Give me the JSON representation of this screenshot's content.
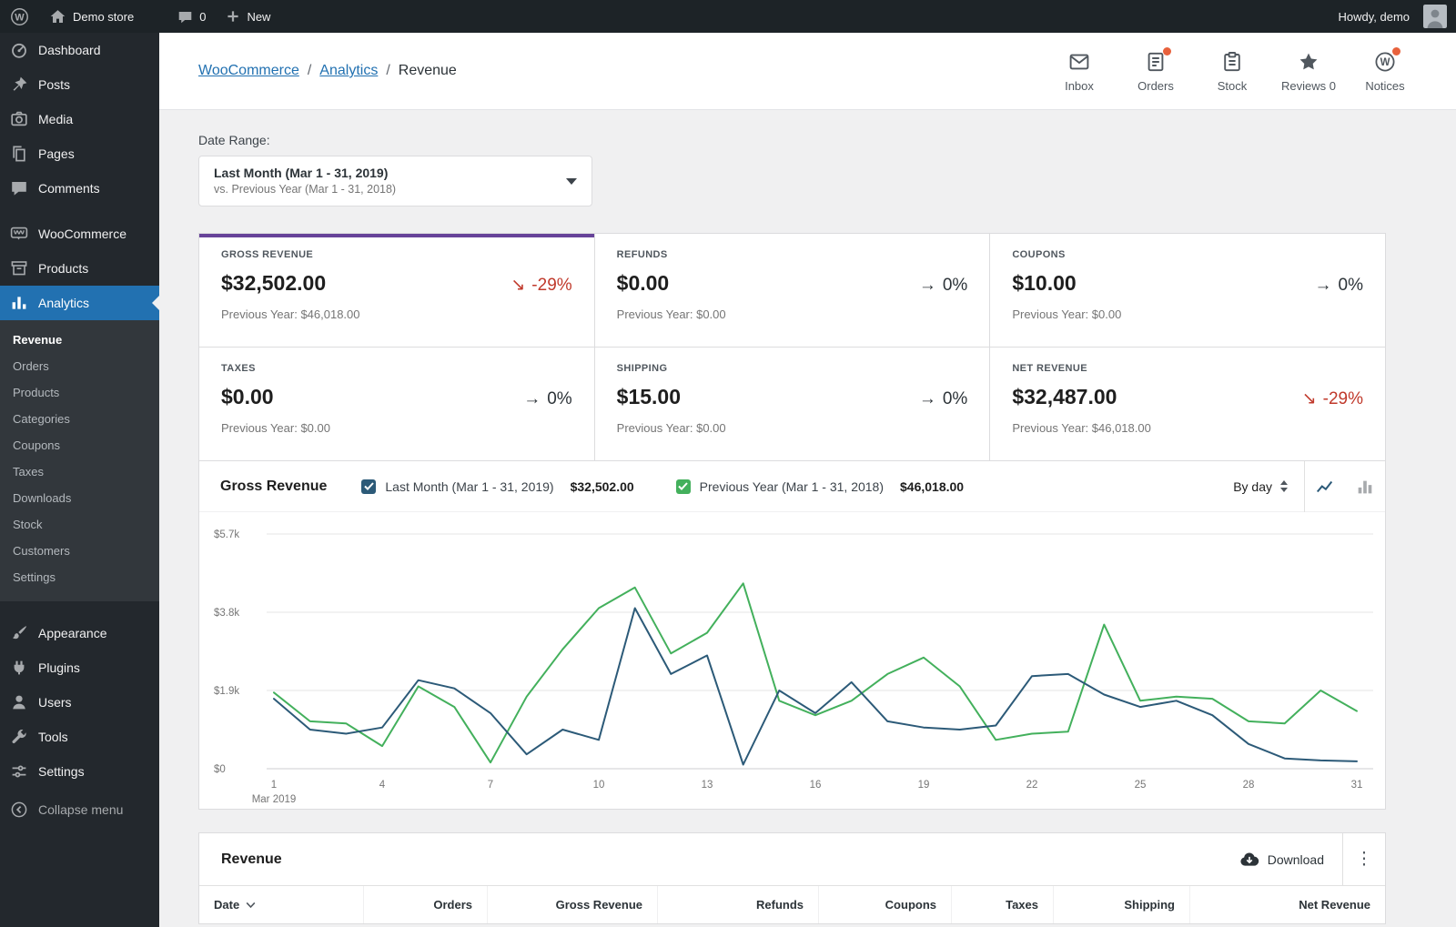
{
  "admin_bar": {
    "site_name": "Demo store",
    "comments_count": "0",
    "new_label": "New",
    "howdy": "Howdy, demo"
  },
  "sidebar": {
    "items": [
      {
        "label": "Dashboard",
        "icon": "dashboard-icon"
      },
      {
        "label": "Posts",
        "icon": "posts-icon"
      },
      {
        "label": "Media",
        "icon": "media-icon"
      },
      {
        "label": "Pages",
        "icon": "pages-icon"
      },
      {
        "label": "Comments",
        "icon": "comments-icon"
      },
      {
        "label": "WooCommerce",
        "icon": "woocommerce-icon"
      },
      {
        "label": "Products",
        "icon": "products-icon"
      },
      {
        "label": "Analytics",
        "icon": "analytics-icon"
      }
    ],
    "active_item": "Analytics",
    "analytics_submenu": [
      "Revenue",
      "Orders",
      "Products",
      "Categories",
      "Coupons",
      "Taxes",
      "Downloads",
      "Stock",
      "Customers",
      "Settings"
    ],
    "active_submenu": "Revenue",
    "lower_items": [
      {
        "label": "Appearance",
        "icon": "appearance-icon"
      },
      {
        "label": "Plugins",
        "icon": "plugins-icon"
      },
      {
        "label": "Users",
        "icon": "users-icon"
      },
      {
        "label": "Tools",
        "icon": "tools-icon"
      },
      {
        "label": "Settings",
        "icon": "settings-icon"
      }
    ],
    "collapse_label": "Collapse menu"
  },
  "header": {
    "breadcrumb": {
      "items": [
        "WooCommerce",
        "Analytics"
      ],
      "current": "Revenue",
      "separator": "/"
    },
    "tabs": [
      {
        "label": "Inbox",
        "icon": "inbox-icon",
        "unread": false
      },
      {
        "label": "Orders",
        "icon": "orders-icon",
        "unread": true
      },
      {
        "label": "Stock",
        "icon": "stock-icon",
        "unread": false
      },
      {
        "label": "Reviews 0",
        "icon": "reviews-icon",
        "unread": false
      },
      {
        "label": "Notices",
        "icon": "notices-icon",
        "unread": true
      }
    ]
  },
  "filters": {
    "date_range_label": "Date Range:",
    "selected_range": "Last Month (Mar 1 - 31, 2019)",
    "compare_range": "vs. Previous Year (Mar 1 - 31, 2018)"
  },
  "summary_cards": [
    {
      "label": "GROSS REVENUE",
      "value": "$32,502.00",
      "arrow": "↘",
      "delta": "-29%",
      "trend": "down",
      "previous": "Previous Year: $46,018.00",
      "selected": true
    },
    {
      "label": "REFUNDS",
      "value": "$0.00",
      "arrow": "→",
      "delta": "0%",
      "trend": "flat",
      "previous": "Previous Year: $0.00",
      "selected": false
    },
    {
      "label": "COUPONS",
      "value": "$10.00",
      "arrow": "→",
      "delta": "0%",
      "trend": "flat",
      "previous": "Previous Year: $0.00",
      "selected": false
    },
    {
      "label": "TAXES",
      "value": "$0.00",
      "arrow": "→",
      "delta": "0%",
      "trend": "flat",
      "previous": "Previous Year: $0.00",
      "selected": false
    },
    {
      "label": "SHIPPING",
      "value": "$15.00",
      "arrow": "→",
      "delta": "0%",
      "trend": "flat",
      "previous": "Previous Year: $0.00",
      "selected": false
    },
    {
      "label": "NET REVENUE",
      "value": "$32,487.00",
      "arrow": "↘",
      "delta": "-29%",
      "trend": "down",
      "previous": "Previous Year: $46,018.00",
      "selected": false
    }
  ],
  "chart_panel": {
    "title": "Gross Revenue",
    "series_controls": [
      {
        "label": "Last Month (Mar 1 - 31, 2019)",
        "total": "$32,502.00",
        "checked": true,
        "color": "#2c5a78"
      },
      {
        "label": "Previous Year (Mar 1 - 31, 2018)",
        "total": "$46,018.00",
        "checked": true,
        "color": "#43b05c"
      }
    ],
    "interval": "By day"
  },
  "chart_data": {
    "type": "line",
    "title": "Gross Revenue",
    "x": [
      1,
      2,
      3,
      4,
      5,
      6,
      7,
      8,
      9,
      10,
      11,
      12,
      13,
      14,
      15,
      16,
      17,
      18,
      19,
      20,
      21,
      22,
      23,
      24,
      25,
      26,
      27,
      28,
      29,
      30,
      31
    ],
    "x_tick_labels": [
      "1",
      "4",
      "7",
      "10",
      "13",
      "16",
      "19",
      "22",
      "25",
      "28",
      "31"
    ],
    "x_axis_secondary": "Mar 2019",
    "y_ticks": [
      0,
      1900,
      3800,
      5700
    ],
    "y_tick_labels": [
      "$0",
      "$1.9k",
      "$3.8k",
      "$5.7k"
    ],
    "ylim": [
      0,
      5700
    ],
    "grid": "horizontal",
    "legend_position": "top",
    "series": [
      {
        "name": "Last Month (Mar 1 - 31, 2019)",
        "color": "#2c5a78",
        "values": [
          1700,
          950,
          850,
          1000,
          2150,
          1950,
          1350,
          350,
          950,
          700,
          3900,
          2300,
          2750,
          100,
          1900,
          1350,
          2100,
          1150,
          1000,
          950,
          1050,
          2250,
          2300,
          1800,
          1500,
          1650,
          1300,
          600,
          250,
          200,
          180
        ]
      },
      {
        "name": "Previous Year (Mar 1 - 31, 2018)",
        "color": "#43b05c",
        "values": [
          1850,
          1150,
          1100,
          550,
          2000,
          1500,
          150,
          1750,
          2900,
          3900,
          4400,
          2800,
          3300,
          4500,
          1650,
          1300,
          1650,
          2300,
          2700,
          2000,
          700,
          850,
          900,
          3500,
          1650,
          1750,
          1700,
          1150,
          1100,
          1900,
          1400
        ]
      }
    ]
  },
  "table_panel": {
    "title": "Revenue",
    "download_label": "Download",
    "columns": [
      {
        "label": "Date",
        "sorted": "desc",
        "align": "left"
      },
      {
        "label": "Orders",
        "align": "right"
      },
      {
        "label": "Gross Revenue",
        "align": "right"
      },
      {
        "label": "Refunds",
        "align": "right"
      },
      {
        "label": "Coupons",
        "align": "right"
      },
      {
        "label": "Taxes",
        "align": "right"
      },
      {
        "label": "Shipping",
        "align": "right"
      },
      {
        "label": "Net Revenue",
        "align": "right"
      }
    ]
  },
  "colors": {
    "accent_blue": "#2271b1",
    "selected_card_bar": "#674399",
    "negative": "#c0392b",
    "series_current": "#2c5a78",
    "series_previous": "#43b05c",
    "unread_badge": "#e8613c"
  }
}
